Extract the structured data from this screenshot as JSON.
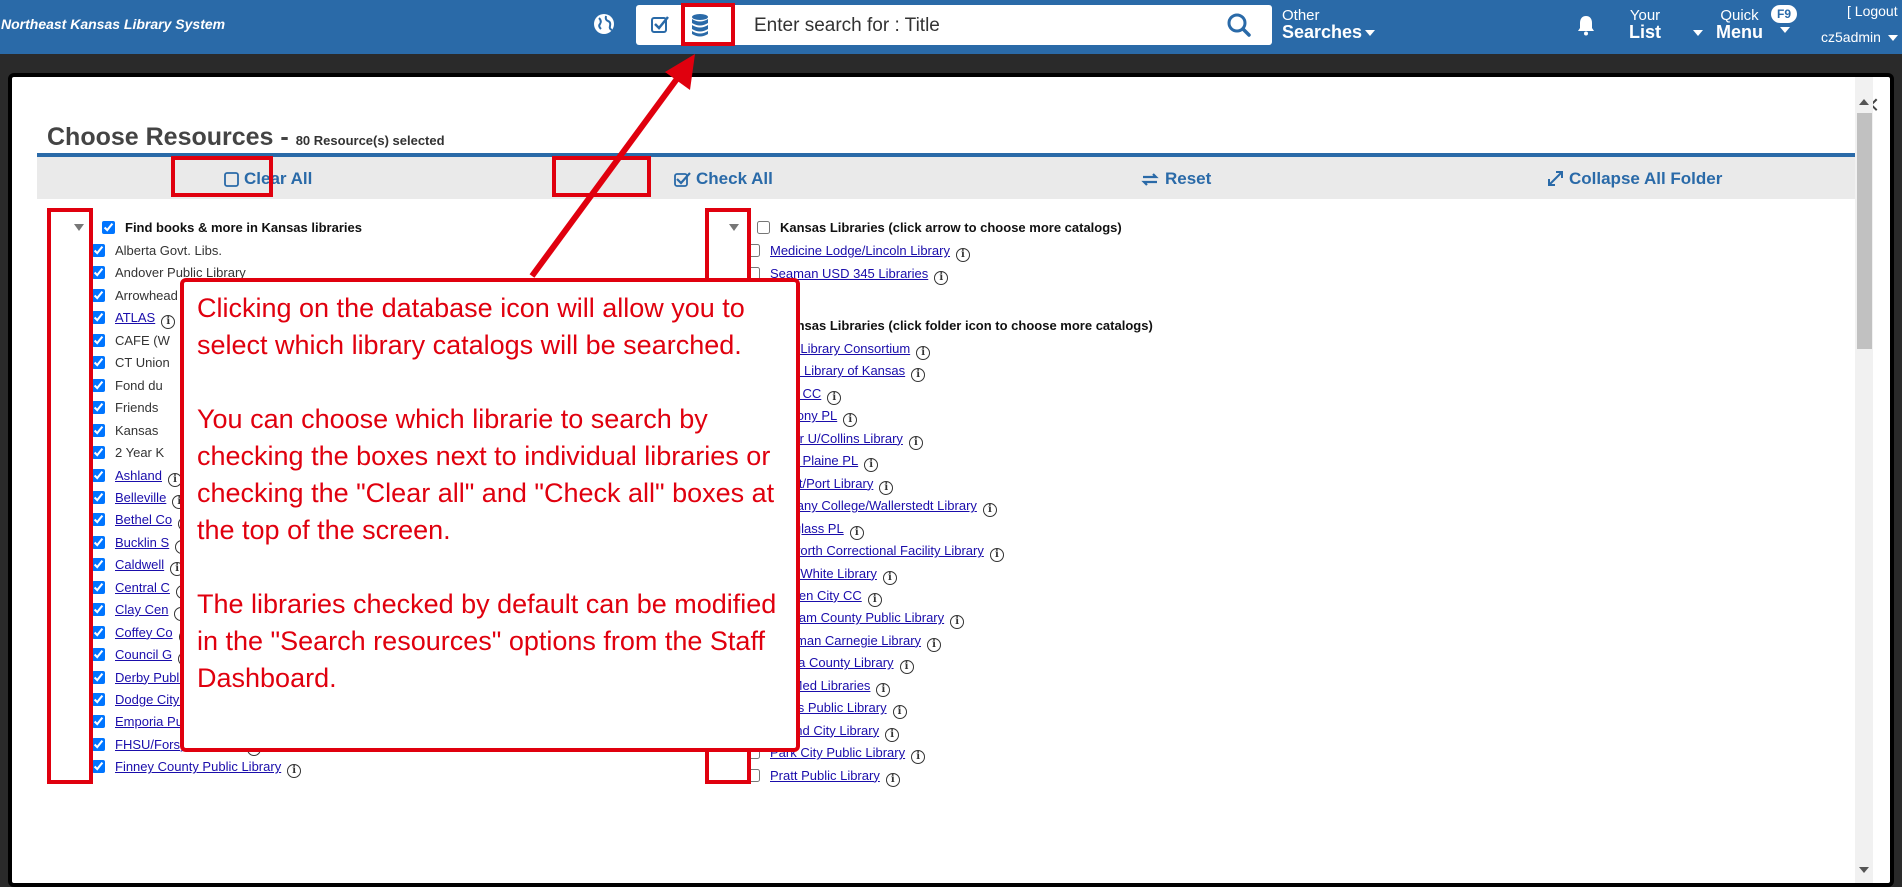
{
  "header": {
    "brand": "Northeast Kansas Library System",
    "search_placeholder": "Enter search for : Title",
    "other_searches_top": "Other",
    "other_searches_bottom": "Searches",
    "your_list_top": "Your",
    "your_list_bottom": "List",
    "quick_menu_top": "Quick",
    "quick_menu_bottom": "Menu",
    "f9_badge": "F9",
    "logout": "[ Logout",
    "username": "cz5admin"
  },
  "modal": {
    "title": "Choose Resources -",
    "selected_count": "80 Resource(s) selected",
    "close": "×",
    "toolbar": {
      "clear_all": "Clear All",
      "check_all": "Check All",
      "reset": "Reset",
      "collapse": "Collapse All Folder"
    }
  },
  "left_group": {
    "label": "Find books & more in Kansas libraries",
    "checked": true,
    "items": [
      {
        "label": "Alberta Govt. Libs.",
        "link": false,
        "checked": true
      },
      {
        "label": "Andover Public Library",
        "link": false,
        "checked": true
      },
      {
        "label": "Arrowhead",
        "link": false,
        "checked": true
      },
      {
        "label": "ATLAS",
        "link": true,
        "checked": true
      },
      {
        "label": "CAFE (W",
        "link": false,
        "checked": true
      },
      {
        "label": "CT Union",
        "link": false,
        "checked": true
      },
      {
        "label": "Fond du",
        "link": false,
        "checked": true
      },
      {
        "label": "Friends",
        "link": false,
        "checked": true
      },
      {
        "label": "Kansas",
        "link": false,
        "checked": true
      },
      {
        "label": "2 Year K",
        "link": false,
        "checked": true
      },
      {
        "label": "Ashland",
        "link": true,
        "checked": true
      },
      {
        "label": "Belleville",
        "link": true,
        "checked": true
      },
      {
        "label": "Bethel Co",
        "link": true,
        "checked": true
      },
      {
        "label": "Bucklin S",
        "link": true,
        "checked": true
      },
      {
        "label": "Caldwell",
        "link": true,
        "checked": true
      },
      {
        "label": "Central C",
        "link": true,
        "checked": true
      },
      {
        "label": "Clay Cen",
        "link": true,
        "checked": true
      },
      {
        "label": "Coffey Co",
        "link": true,
        "checked": true
      },
      {
        "label": "Council G",
        "link": true,
        "checked": true
      },
      {
        "label": "Derby Public Library",
        "link": true,
        "checked": true
      },
      {
        "label": "Dodge City Public Library",
        "link": true,
        "checked": true
      },
      {
        "label": "Emporia Public Library",
        "link": true,
        "checked": true
      },
      {
        "label": "FHSU/Forsyth Library",
        "link": true,
        "checked": true
      },
      {
        "label": "Finney County Public Library",
        "link": true,
        "checked": true
      }
    ]
  },
  "right_group1": {
    "label": "Kansas Libraries (click arrow to choose more catalogs)",
    "checked": false,
    "items": [
      {
        "label": "Medicine Lodge/Lincoln Library",
        "checked": false
      },
      {
        "label": "Seaman USD 345 Libraries",
        "checked": false
      }
    ]
  },
  "right_group2": {
    "label": "Kansas Libraries (click folder icon to choose more catalogs)",
    "checked": true,
    "items": [
      {
        "label": "PSU Library Consortium",
        "checked": true
      },
      {
        "label": "State Library of Kansas",
        "checked": true
      },
      {
        "label": "Allen CC",
        "checked": false
      },
      {
        "label": "Anthony PL",
        "checked": false
      },
      {
        "label": "Baker U/Collins Library",
        "checked": false
      },
      {
        "label": "Belle Plaine PL",
        "checked": false
      },
      {
        "label": "Beloit/Port Library",
        "checked": false
      },
      {
        "label": "Bethany College/Wallerstedt Library",
        "checked": false
      },
      {
        "label": "Douglass PL",
        "checked": false
      },
      {
        "label": "Ellsworth Correctional Facility Library",
        "checked": false
      },
      {
        "label": "ESU/White Library",
        "checked": false
      },
      {
        "label": "Garden City CC",
        "checked": false
      },
      {
        "label": "Graham County Public Library",
        "checked": false
      },
      {
        "label": "Kingman Carnegie Library",
        "checked": false
      },
      {
        "label": "Kiowa County Library",
        "checked": false
      },
      {
        "label": "KU Med Libraries",
        "checked": false
      },
      {
        "label": "Lyons Public Library",
        "checked": false
      },
      {
        "label": "Mound City Library",
        "checked": false
      },
      {
        "label": "Park City Public Library",
        "checked": false
      },
      {
        "label": "Pratt Public Library",
        "checked": false
      }
    ]
  },
  "callout": {
    "p1": "Clicking on the database icon will allow you to select which library catalogs will be searched.",
    "p2": "You can choose which librarie to search by checking the boxes next to individual libraries or checking the \"Clear all\" and \"Check all\" boxes at the top of the screen.",
    "p3": "The libraries checked by default can be modified in the \"Search resources\" options from the Staff Dashboard."
  },
  "colors": {
    "header_blue": "#2a6aa8",
    "annotation_red": "#e0000e",
    "link_blue": "#1a0dab"
  }
}
